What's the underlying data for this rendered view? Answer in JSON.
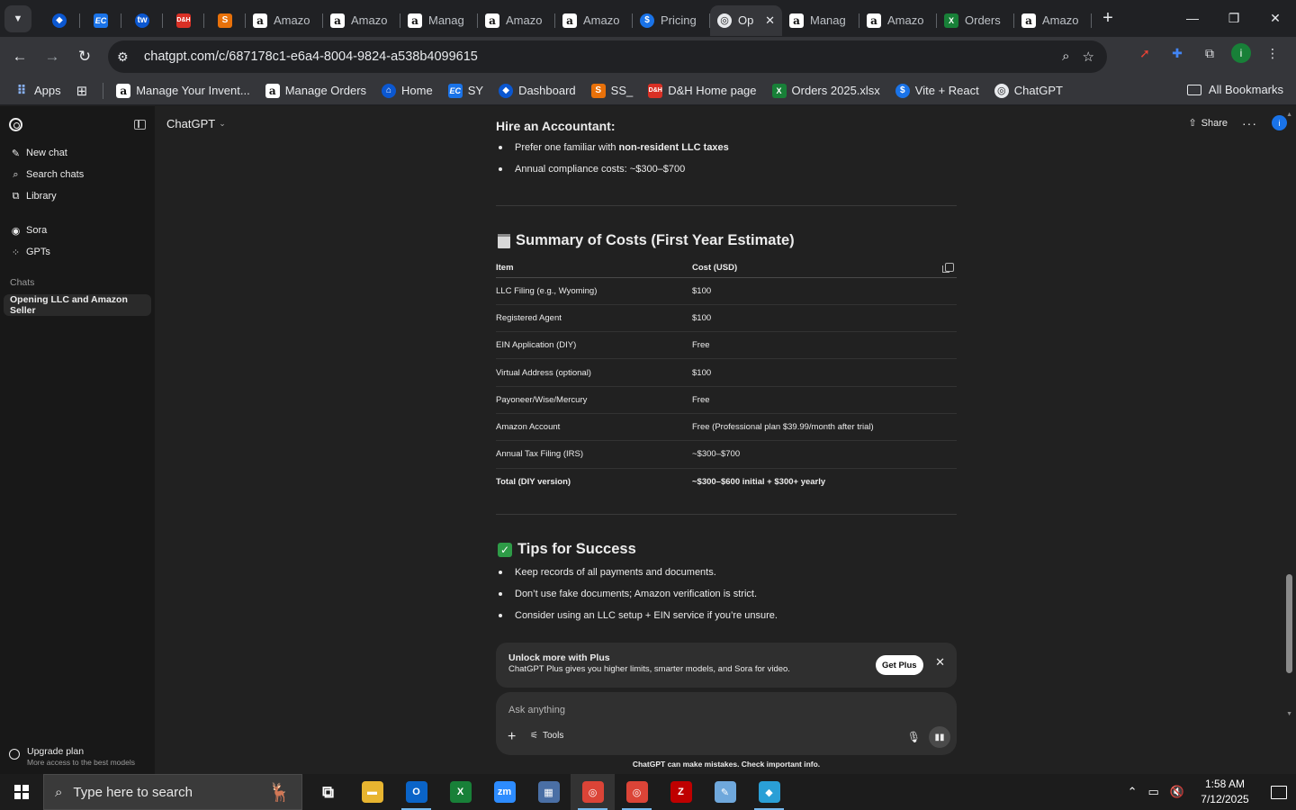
{
  "browser": {
    "tabs": [
      {
        "kind": "icon",
        "icon": "edge-icon"
      },
      {
        "kind": "icon",
        "icon": "ec-icon",
        "glyph": "EC"
      },
      {
        "kind": "icon",
        "icon": "tw-icon",
        "glyph": "tw"
      },
      {
        "kind": "icon",
        "icon": "dh-icon",
        "glyph": "D&H"
      },
      {
        "kind": "icon",
        "icon": "ss-icon",
        "glyph": "S"
      },
      {
        "kind": "titled",
        "icon": "amazon-icon",
        "title": "Amazo"
      },
      {
        "kind": "titled",
        "icon": "amazon-icon",
        "title": "Amazo"
      },
      {
        "kind": "titled",
        "icon": "amazon-icon",
        "title": "Manag"
      },
      {
        "kind": "titled",
        "icon": "amazon-icon",
        "title": "Amazo"
      },
      {
        "kind": "titled",
        "icon": "amazon-icon",
        "title": "Amazo"
      },
      {
        "kind": "titled",
        "icon": "dollar-icon",
        "title": "Pricing"
      },
      {
        "kind": "active",
        "icon": "chatgpt-icon",
        "title": "Op"
      },
      {
        "kind": "titled",
        "icon": "amazon-icon",
        "title": "Manag"
      },
      {
        "kind": "titled",
        "icon": "amazon-icon",
        "title": "Amazo"
      },
      {
        "kind": "titled",
        "icon": "excel-icon",
        "title": "Orders"
      },
      {
        "kind": "titled",
        "icon": "amazon-icon",
        "title": "Amazo"
      }
    ],
    "url": "chatgpt.com/c/687178c1-e6a4-8004-9824-a538b4099615",
    "bookmarks": [
      {
        "icon": "apps-icon",
        "label": "Apps"
      },
      {
        "icon": "amazon-icon",
        "label": "Manage Your Invent..."
      },
      {
        "icon": "amazon-icon",
        "label": "Manage Orders"
      },
      {
        "icon": "home-icon",
        "label": "Home"
      },
      {
        "icon": "ec-icon",
        "label": "SY"
      },
      {
        "icon": "dashboard-icon",
        "label": "Dashboard"
      },
      {
        "icon": "ss-icon",
        "label": "SS_"
      },
      {
        "icon": "dh-icon",
        "label": "D&H Home page"
      },
      {
        "icon": "excel-icon",
        "label": "Orders 2025.xlsx"
      },
      {
        "icon": "dollar-icon",
        "label": "Vite + React"
      },
      {
        "icon": "chatgpt-icon",
        "label": "ChatGPT"
      }
    ],
    "all_bookmarks": "All Bookmarks",
    "profile_initial": "i"
  },
  "sidebar": {
    "items": [
      {
        "icon": "new-chat-icon",
        "label": "New chat"
      },
      {
        "icon": "search-icon",
        "label": "Search chats"
      },
      {
        "icon": "library-icon",
        "label": "Library"
      }
    ],
    "items2": [
      {
        "icon": "sora-icon",
        "label": "Sora"
      },
      {
        "icon": "gpts-icon",
        "label": "GPTs"
      }
    ],
    "chats_heading": "Chats",
    "active_chat": "Opening LLC and Amazon Seller",
    "upgrade_title": "Upgrade plan",
    "upgrade_sub": "More access to the best models"
  },
  "header": {
    "model": "ChatGPT",
    "share": "Share",
    "user_initial": "i"
  },
  "message": {
    "accountant_heading": "Hire an Accountant:",
    "accountant_bullets": [
      {
        "pre": "Prefer one familiar with ",
        "bold": "non-resident LLC taxes"
      },
      {
        "pre": "Annual compliance costs: ~$300–$700",
        "bold": ""
      }
    ],
    "summary_heading": "Summary of Costs (First Year Estimate)",
    "table_headers": [
      "Item",
      "Cost (USD)"
    ],
    "table_rows": [
      [
        "LLC Filing (e.g., Wyoming)",
        "$100"
      ],
      [
        "Registered Agent",
        "$100"
      ],
      [
        "EIN Application (DIY)",
        "Free"
      ],
      [
        "Virtual Address (optional)",
        "$100"
      ],
      [
        "Payoneer/Wise/Mercury",
        "Free"
      ],
      [
        "Amazon Account",
        "Free (Professional plan $39.99/month after trial)"
      ],
      [
        "Annual Tax Filing (IRS)",
        "~$300–$700"
      ],
      [
        "Total (DIY version)",
        "~$300–$600 initial + $300+ yearly"
      ]
    ],
    "tips_heading": "Tips for Success",
    "tips": [
      "Keep records of all payments and documents.",
      "Don’t use fake documents; Amazon verification is strict.",
      "Consider using an LLC setup + EIN service if you’re unsure."
    ]
  },
  "banner": {
    "title": "Unlock more with Plus",
    "subtitle": "ChatGPT Plus gives you higher limits, smarter models, and Sora for video.",
    "button": "Get Plus"
  },
  "composer": {
    "placeholder": "Ask anything",
    "tools": "Tools",
    "disclaimer": "ChatGPT can make mistakes. Check important info."
  },
  "taskbar": {
    "search_placeholder": "Type here to search",
    "time": "1:58 AM",
    "date": "7/12/2025",
    "apps": [
      {
        "name": "task-view-icon",
        "glyph": "⧉",
        "color": "transparent",
        "state": ""
      },
      {
        "name": "file-explorer-icon",
        "glyph": "▬",
        "color": "#e8b530",
        "state": ""
      },
      {
        "name": "outlook-icon",
        "glyph": "O",
        "color": "#0a64c8",
        "state": "open"
      },
      {
        "name": "excel-icon",
        "glyph": "X",
        "color": "#188038",
        "state": ""
      },
      {
        "name": "zoom-icon",
        "glyph": "zm",
        "color": "#2d8cff",
        "state": ""
      },
      {
        "name": "calculator-icon",
        "glyph": "▦",
        "color": "#4a6fa5",
        "state": ""
      },
      {
        "name": "chrome-icon",
        "glyph": "◎",
        "color": "#db4437",
        "state": "active"
      },
      {
        "name": "chrome-profile-icon",
        "glyph": "◎",
        "color": "#db4437",
        "state": "open"
      },
      {
        "name": "filezilla-icon",
        "glyph": "Z",
        "color": "#bf0000",
        "state": ""
      },
      {
        "name": "notepad-icon",
        "glyph": "✎",
        "color": "#6fa8dc",
        "state": ""
      },
      {
        "name": "app-diamond-icon",
        "glyph": "◆",
        "color": "#2a9fd6",
        "state": "open"
      }
    ]
  }
}
